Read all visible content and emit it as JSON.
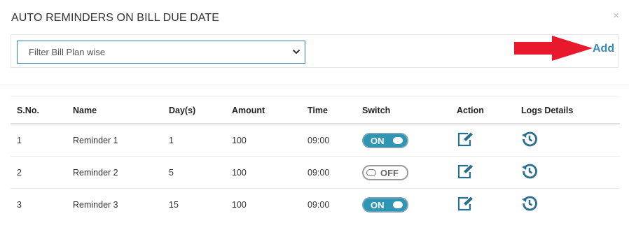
{
  "modal": {
    "title": "AUTO REMINDERS ON BILL DUE DATE",
    "close_symbol": "×"
  },
  "filter": {
    "selected": "Filter Bill Plan wise",
    "add_label": "Add"
  },
  "colors": {
    "accent": "#2e96b3",
    "link": "#3b8bb5",
    "arrow": "#e8192c"
  },
  "table": {
    "headers": [
      "S.No.",
      "Name",
      "Day(s)",
      "Amount",
      "Time",
      "Switch",
      "Action",
      "Logs Details"
    ],
    "rows": [
      {
        "sno": "1",
        "name": "Reminder 1",
        "days": "1",
        "amount": "100",
        "time": "09:00",
        "switch": "ON",
        "action_icon": "edit-icon",
        "logs_icon": "history-icon"
      },
      {
        "sno": "2",
        "name": "Reminder 2",
        "days": "5",
        "amount": "100",
        "time": "09:00",
        "switch": "OFF",
        "action_icon": "edit-icon",
        "logs_icon": "history-icon"
      },
      {
        "sno": "3",
        "name": "Reminder 3",
        "days": "15",
        "amount": "100",
        "time": "09:00",
        "switch": "ON",
        "action_icon": "edit-icon",
        "logs_icon": "history-icon"
      }
    ]
  }
}
